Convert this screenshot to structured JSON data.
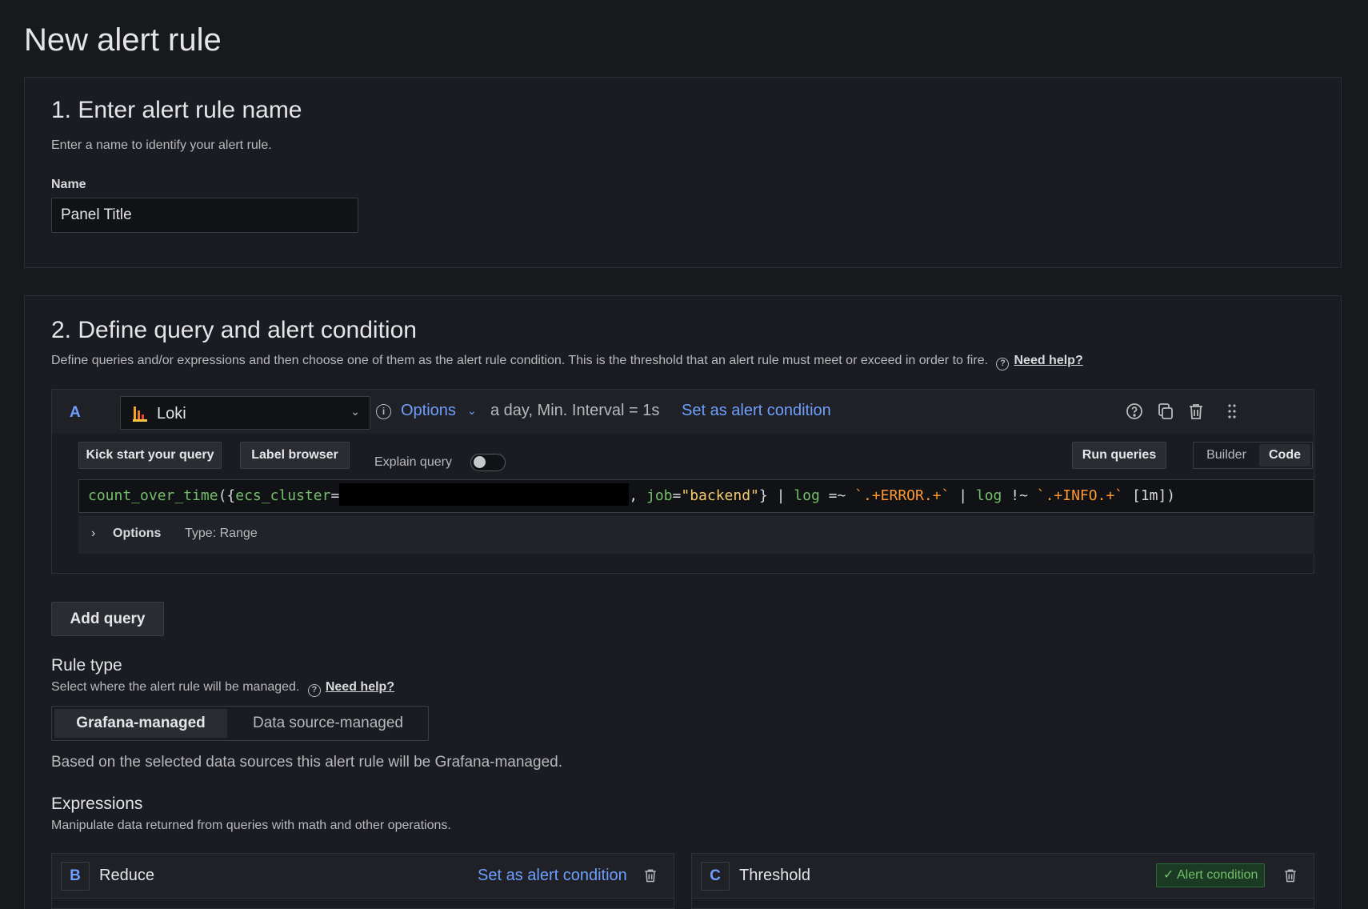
{
  "page": {
    "title": "New alert rule"
  },
  "section1": {
    "title": "1. Enter alert rule name",
    "desc": "Enter a name to identify your alert rule.",
    "name_label": "Name",
    "name_value": "Panel Title"
  },
  "section2": {
    "title": "2. Define query and alert condition",
    "desc": "Define queries and/or expressions and then choose one of them as the alert rule condition. This is the threshold that an alert rule must meet or exceed in order to fire.",
    "help_link": "Need help?",
    "query": {
      "letter": "A",
      "datasource": "Loki",
      "options_label": "Options",
      "interval_text": "a day, Min. Interval = 1s",
      "set_condition": "Set as alert condition",
      "kick_start": "Kick start your query",
      "label_browser": "Label browser",
      "explain_query": "Explain query",
      "explain_enabled": false,
      "run_queries": "Run queries",
      "mode_builder": "Builder",
      "mode_code": "Code",
      "code": {
        "fn": "count_over_time",
        "open": "({",
        "label": "ecs_cluster",
        "eq": "=",
        "sep": ", ",
        "job_label": "job",
        "job_eq": "=",
        "job_value": "\"backend\"",
        "close": "}",
        "pipe1": " | ",
        "log1": "log",
        "op1": " =~ ",
        "re1": "`.+ERROR.+`",
        "pipe2": " | ",
        "log2": "log",
        "op2": " !~ ",
        "re2": "`.+INFO.+`",
        "range": " [1m])"
      },
      "options_row_label": "Options",
      "options_row_type": "Type: Range"
    },
    "add_query": "Add query",
    "rule_type": {
      "title": "Rule type",
      "desc": "Select where the alert rule will be managed.",
      "help_link": "Need help?",
      "options": [
        "Grafana-managed",
        "Data source-managed"
      ],
      "selected": "Grafana-managed",
      "note": "Based on the selected data sources this alert rule will be Grafana-managed."
    },
    "expressions": {
      "title": "Expressions",
      "desc": "Manipulate data returned from queries with math and other operations.",
      "cards": [
        {
          "letter": "B",
          "name": "Reduce",
          "action": "Set as alert condition"
        },
        {
          "letter": "C",
          "name": "Threshold",
          "badge": "✓ Alert condition"
        }
      ]
    }
  },
  "colors": {
    "accent": "#6e9fff",
    "success": "#73bf69",
    "background": "#18191d"
  }
}
